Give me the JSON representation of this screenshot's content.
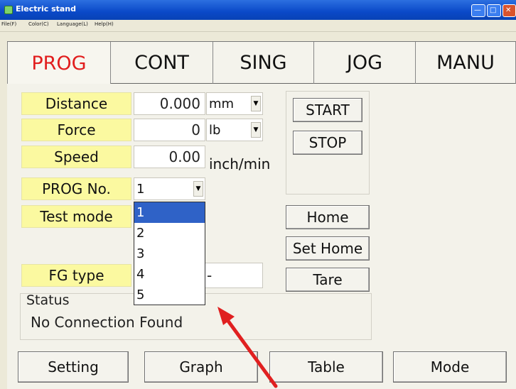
{
  "window": {
    "title": "Electric stand"
  },
  "menu": [
    "File(F)",
    "Color(C)",
    "Language(L)",
    "Help(H)"
  ],
  "tabs": [
    "PROG",
    "CONT",
    "SING",
    "JOG",
    "MANU"
  ],
  "fields": {
    "distance": {
      "label": "Distance",
      "value": "0.000",
      "unit": "mm"
    },
    "force": {
      "label": "Force",
      "value": "0",
      "unit": "lb"
    },
    "speed": {
      "label": "Speed",
      "value": "0.00",
      "unit": "inch/min"
    },
    "prog_no": {
      "label": "PROG No.",
      "value": "1"
    },
    "test_mode": {
      "label": "Test mode"
    },
    "fg_type": {
      "label": "FG type",
      "value": "-"
    }
  },
  "prog_options": [
    "1",
    "2",
    "3",
    "4",
    "5"
  ],
  "buttons": {
    "start": "START",
    "stop": "STOP",
    "home": "Home",
    "set_home": "Set Home",
    "tare": "Tare"
  },
  "status": {
    "title": "Status",
    "text": "No Connection Found"
  },
  "bottom_buttons": [
    "Setting",
    "Graph",
    "Table",
    "Mode"
  ],
  "colors": {
    "active_tab": "#e11d1d",
    "label_bg": "#fbf9a0",
    "selection": "#2f62c7",
    "arrow": "#e02020"
  }
}
